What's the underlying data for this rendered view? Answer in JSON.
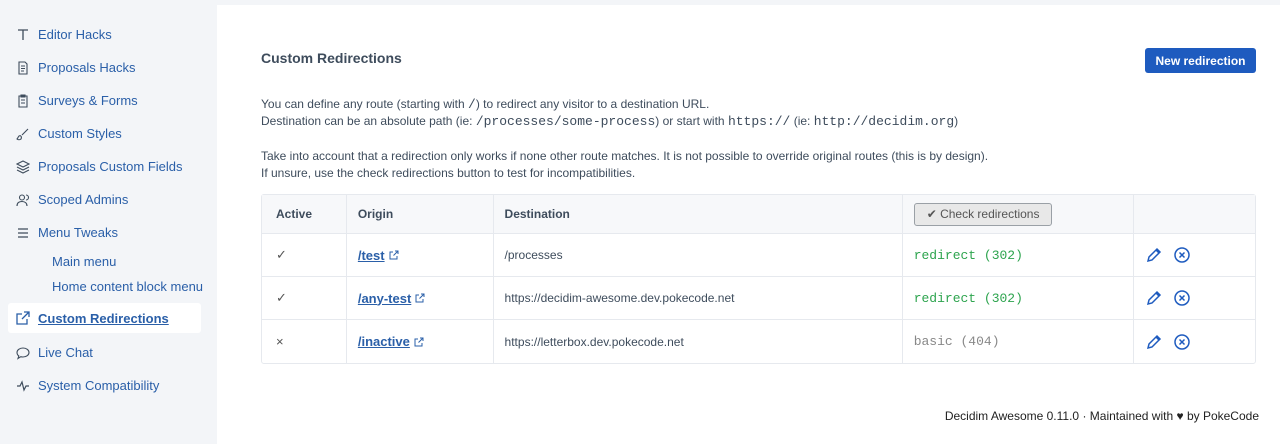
{
  "sidebar": {
    "items": [
      {
        "label": "Editor Hacks",
        "icon": "text-icon"
      },
      {
        "label": "Proposals Hacks",
        "icon": "document-icon"
      },
      {
        "label": "Surveys & Forms",
        "icon": "clipboard-icon"
      },
      {
        "label": "Custom Styles",
        "icon": "brush-icon"
      },
      {
        "label": "Proposals Custom Fields",
        "icon": "stack-icon"
      },
      {
        "label": "Scoped Admins",
        "icon": "users-icon"
      },
      {
        "label": "Menu Tweaks",
        "icon": "menu-icon"
      }
    ],
    "sub_items": [
      "Main menu",
      "Home content block menu"
    ],
    "items_after": [
      {
        "label": "Custom Redirections",
        "icon": "external-link-icon",
        "active": true
      },
      {
        "label": "Live Chat",
        "icon": "chat-icon"
      },
      {
        "label": "System Compatibility",
        "icon": "pulse-icon"
      }
    ]
  },
  "main": {
    "title": "Custom Redirections",
    "new_button": "New redirection",
    "desc_line1_a": "You can define any route (starting with ",
    "desc_line1_code": "/",
    "desc_line1_b": ") to redirect any visitor to a destination URL.",
    "desc_line2_a": "Destination can be an absolute path (ie: ",
    "desc_line2_code1": "/processes/some-process",
    "desc_line2_b": ") or start with ",
    "desc_line2_code2": "https://",
    "desc_line2_c": " (ie: ",
    "desc_line2_code3": "http://decidim.org",
    "desc_line2_d": ")",
    "note_line1": "Take into account that a redirection only works if none other route matches. It is not possible to override original routes (this is by design).",
    "note_line2": "If unsure, use the check redirections button to test for incompatibilities."
  },
  "table": {
    "headers": {
      "active": "Active",
      "origin": "Origin",
      "destination": "Destination",
      "check_button": "✔ Check redirections"
    },
    "rows": [
      {
        "active": "✓",
        "origin": "/test",
        "destination": "/processes",
        "status": "redirect (302)"
      },
      {
        "active": "✓",
        "origin": "/any-test",
        "destination": "https://decidim-awesome.dev.pokecode.net",
        "status": "redirect (302)"
      },
      {
        "active": "×",
        "origin": "/inactive",
        "destination": "https://letterbox.dev.pokecode.net",
        "status": "basic (404)"
      }
    ]
  },
  "footer": "Decidim Awesome 0.11.0 · Maintained with ♥ by PokeCode",
  "colors": {
    "accent": "#1e5bbf",
    "link": "#2a5fa8",
    "ok": "#2da44e"
  }
}
